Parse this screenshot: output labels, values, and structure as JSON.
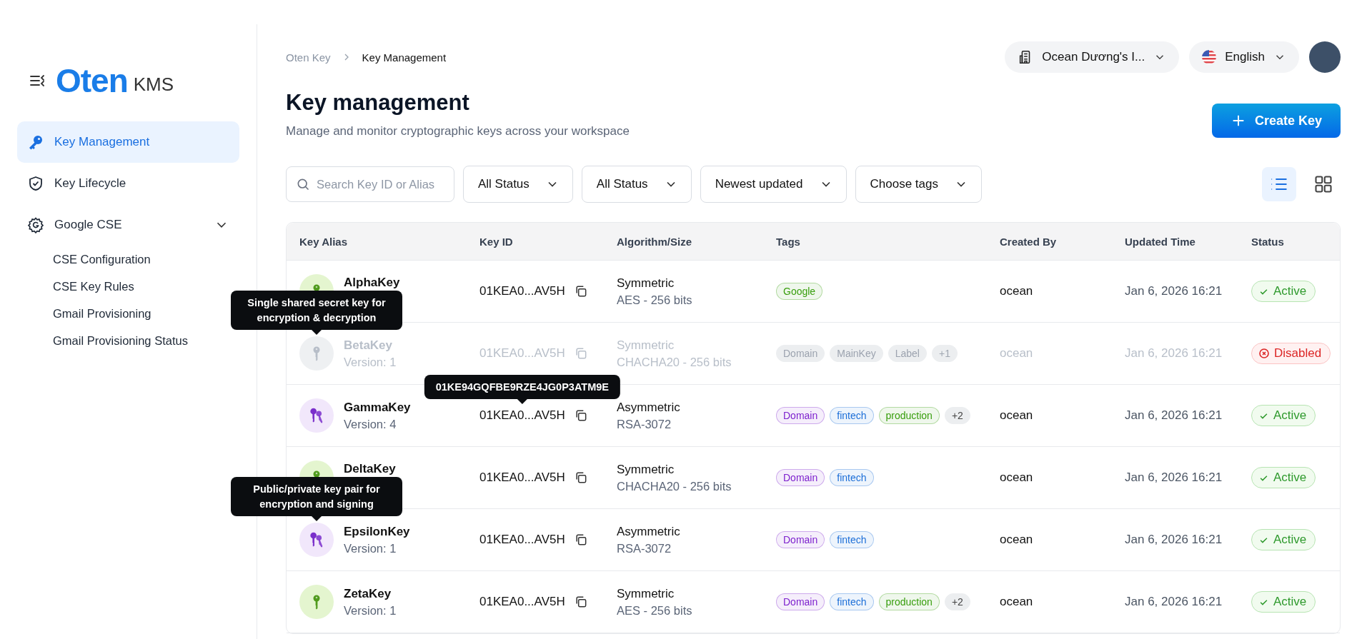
{
  "sidebar": {
    "logo": {
      "name": "Oten",
      "product": "KMS"
    },
    "items": [
      {
        "label": "Key Management",
        "selected": true
      },
      {
        "label": "Key Lifecycle",
        "selected": false
      },
      {
        "label": "Google CSE",
        "selected": false,
        "expanded": true,
        "children": [
          {
            "label": "CSE Configuration",
            "selected": false
          },
          {
            "label": "CSE Key Rules",
            "selected": false
          },
          {
            "label": "Gmail Provisioning",
            "selected": false
          },
          {
            "label": "Gmail Provisioning Status",
            "selected": false
          }
        ]
      }
    ]
  },
  "header": {
    "breadcrumbs": [
      "Oten Key",
      "Key Management"
    ],
    "workspace": "Ocean Dương's I...",
    "language": "English"
  },
  "page": {
    "title": "Key management",
    "subtitle": "Manage and monitor cryptographic keys across your workspace",
    "create_button": "Create Key"
  },
  "filters": {
    "search": {
      "placeholder": "Search Key ID or Alias"
    },
    "dropdowns": [
      "All Status",
      "All Status",
      "Newest updated",
      "Choose tags"
    ],
    "views": [
      {
        "kind": "list",
        "selected": true
      },
      {
        "kind": "grid",
        "selected": false
      }
    ]
  },
  "table": {
    "columns": [
      "Key Alias",
      "Key ID",
      "Algorithm/Size",
      "Tags",
      "Created By",
      "Updated Time",
      "Status"
    ],
    "rows": [
      {
        "alias": "AlphaKey",
        "kind": "symmetric",
        "disabled": false,
        "key_id": "01KEA0...AV5H",
        "algorithm": "Symmetric",
        "algorithm_detail": "AES - 256 bits",
        "tags": [
          {
            "label": "Google",
            "color": "#389e0d"
          }
        ],
        "created_by": "ocean",
        "updated": "Jan 6, 2026 16:21",
        "status": {
          "label": "Active",
          "kind": "active"
        }
      },
      {
        "alias": "BetaKey",
        "version": "Version: 1",
        "kind": "symmetric",
        "disabled": true,
        "key_id": "01KEA0...AV5H",
        "algorithm": "Symmetric",
        "algorithm_detail": "CHACHA20 - 256 bits",
        "tags": [
          {
            "label": "Domain",
            "color": "#9ca3af"
          },
          {
            "label": "MainKey",
            "color": "#9ca3af"
          },
          {
            "label": "Label",
            "color": "#9ca3af"
          }
        ],
        "more_tags": "+1",
        "created_by": "ocean",
        "updated": "Jan 6, 2026 16:21",
        "status": {
          "label": "Disabled",
          "kind": "disabled"
        },
        "tooltip": "Single shared secret key for encryption & decryption"
      },
      {
        "alias": "GammaKey",
        "version": "Version: 4",
        "kind": "asymmetric",
        "disabled": false,
        "key_id": "01KEA0...AV5H",
        "key_id_tooltip": "01KE94GQFBE9RZE4JG0P3ATM9E",
        "algorithm": "Asymmetric",
        "algorithm_detail": "RSA-3072",
        "tags": [
          {
            "label": "Domain",
            "color": "#7e22ce"
          },
          {
            "label": "fintech",
            "color": "#1d6fd8"
          },
          {
            "label": "production",
            "color": "#389e0d"
          }
        ],
        "more_tags": "+2",
        "created_by": "ocean",
        "updated": "Jan 6, 2026 16:21",
        "status": {
          "label": "Active",
          "kind": "active"
        }
      },
      {
        "alias": "DeltaKey",
        "kind": "symmetric",
        "disabled": false,
        "key_id": "01KEA0...AV5H",
        "algorithm": "Symmetric",
        "algorithm_detail": "CHACHA20 - 256 bits",
        "tags": [
          {
            "label": "Domain",
            "color": "#7e22ce"
          },
          {
            "label": "fintech",
            "color": "#1d6fd8"
          }
        ],
        "created_by": "ocean",
        "updated": "Jan 6, 2026 16:21",
        "status": {
          "label": "Active",
          "kind": "active"
        }
      },
      {
        "alias": "EpsilonKey",
        "version": "Version: 1",
        "kind": "asymmetric",
        "disabled": false,
        "key_id": "01KEA0...AV5H",
        "algorithm": "Asymmetric",
        "algorithm_detail": "RSA-3072",
        "tags": [
          {
            "label": "Domain",
            "color": "#7e22ce"
          },
          {
            "label": "fintech",
            "color": "#1d6fd8"
          }
        ],
        "created_by": "ocean",
        "updated": "Jan 6, 2026 16:21",
        "status": {
          "label": "Active",
          "kind": "active"
        },
        "tooltip": "Public/private key pair for encryption and signing"
      },
      {
        "alias": "ZetaKey",
        "version": "Version: 1",
        "kind": "symmetric",
        "disabled": false,
        "key_id": "01KEA0...AV5H",
        "algorithm": "Symmetric",
        "algorithm_detail": "AES - 256 bits",
        "tags": [
          {
            "label": "Domain",
            "color": "#7e22ce"
          },
          {
            "label": "fintech",
            "color": "#1d6fd8"
          },
          {
            "label": "production",
            "color": "#389e0d"
          }
        ],
        "more_tags": "+2",
        "created_by": "ocean",
        "updated": "Jan 6, 2026 16:21",
        "status": {
          "label": "Active",
          "kind": "active"
        }
      }
    ]
  }
}
